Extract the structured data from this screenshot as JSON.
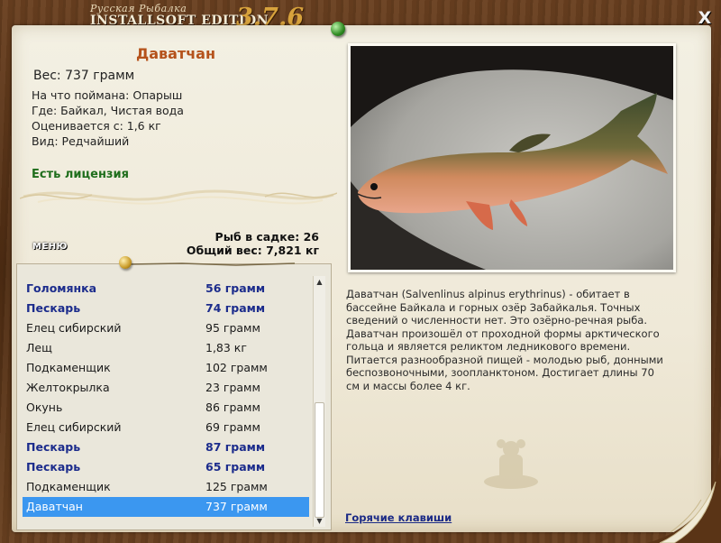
{
  "app": {
    "title_sub": "Русская Рыбалка",
    "title_main": "INSTALLSOFT EDITION",
    "version": "3.7.6",
    "close_label": "X"
  },
  "catch": {
    "name": "Даватчан",
    "weight_label": "Вес: 737 грамм",
    "caught_on": "На что поймана: Опарыш",
    "where": "Где: Байкал, Чистая вода",
    "valued_from": "Оценивается с: 1,6 кг",
    "kind": "Вид: Редчайший",
    "license": "Есть лицензия"
  },
  "cage": {
    "count_label": "Рыб в садке: 26",
    "total_label": "Общий вес: 7,821 кг"
  },
  "menu_label": "МЕНЮ",
  "list": {
    "items": [
      {
        "name": "Голомянка",
        "weight": "56 грамм",
        "bold": true,
        "selected": false
      },
      {
        "name": "Пескарь",
        "weight": "74 грамм",
        "bold": true,
        "selected": false
      },
      {
        "name": "Елец сибирский",
        "weight": "95 грамм",
        "bold": false,
        "selected": false
      },
      {
        "name": "Лещ",
        "weight": "1,83 кг",
        "bold": false,
        "selected": false
      },
      {
        "name": "Подкаменщик",
        "weight": "102 грамм",
        "bold": false,
        "selected": false
      },
      {
        "name": "Желтокрылка",
        "weight": "23 грамм",
        "bold": false,
        "selected": false
      },
      {
        "name": "Окунь",
        "weight": "86 грамм",
        "bold": false,
        "selected": false
      },
      {
        "name": "Елец сибирский",
        "weight": "69 грамм",
        "bold": false,
        "selected": false
      },
      {
        "name": "Пескарь",
        "weight": "87 грамм",
        "bold": true,
        "selected": false
      },
      {
        "name": "Пескарь",
        "weight": "65 грамм",
        "bold": true,
        "selected": false
      },
      {
        "name": "Подкаменщик",
        "weight": "125 грамм",
        "bold": false,
        "selected": false
      },
      {
        "name": "Даватчан",
        "weight": "737 грамм",
        "bold": false,
        "selected": true
      }
    ]
  },
  "description": "Даватчан (Salvenlinus alpinus erythrinus) - обитает в бассейне Байкала и горных озёр Забайкалья. Точных сведений о численности нет. Это озёрно-речная рыба. Даватчан произошёл от проходной формы арктического гольца и является реликтом ледникового времени. Питается разнообразной пищей - молодью рыб, донными беспозвоночными, зоопланктоном. Достигает длины 70 см и массы более 4 кг.",
  "hotkeys_label": "Горячие клавиши",
  "colors": {
    "fish_name": "#b5521b",
    "license": "#1f6e1c",
    "bold_row": "#1c2c8c",
    "selection": "#3b97f0",
    "wood": "#5b3517",
    "parchment": "#f1ede0"
  }
}
